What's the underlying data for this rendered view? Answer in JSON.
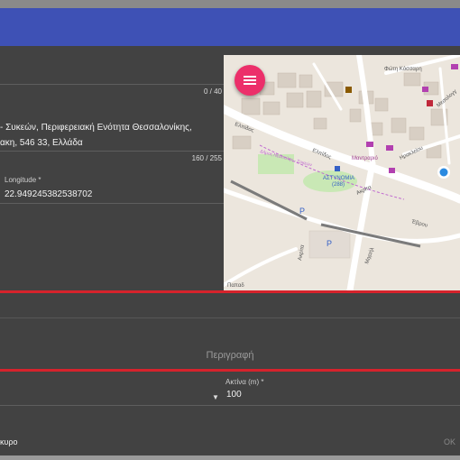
{
  "form": {
    "name_counter": "0 / 40",
    "address_line1": "- Συκεών, Περιφερειακή Ενότητα Θεσσαλονίκης,",
    "address_line2": "ακη, 546 33, Ελλάδα",
    "address_counter": "160 / 255",
    "longitude_label": "Longitude *",
    "longitude_value": "22.949245382538702",
    "description_placeholder": "Περιγραφή",
    "radius_label": "Ακτίνα (m) *",
    "radius_value": "100"
  },
  "map": {
    "labels": [
      "Φώτη Κόσσαρη",
      "Ελπίδος",
      "Ελπίδος",
      "Μαντραριό",
      "Ηρακλείου",
      "ΑΣΤΥΝΟΜΙΑ",
      "(288)",
      "Ακρίτα",
      "Έβρου",
      "Μεσολογγ",
      "Παπαδ",
      "Ακρίτα",
      "Δήμος Νεάπολης - Συκεών",
      "Μιχαήλ",
      "P",
      "P"
    ]
  },
  "actions": {
    "cancel_label": "κυρο",
    "ok_label": "OK"
  },
  "icons": {
    "fab": "menu-icon",
    "dropdown": "dropdown-arrow-icon",
    "location": "location-dot-icon"
  },
  "colors": {
    "topbar": "#3e51b5",
    "fab": "#ec2f6a",
    "accent_line": "#d6232c",
    "dialog": "#424242"
  }
}
